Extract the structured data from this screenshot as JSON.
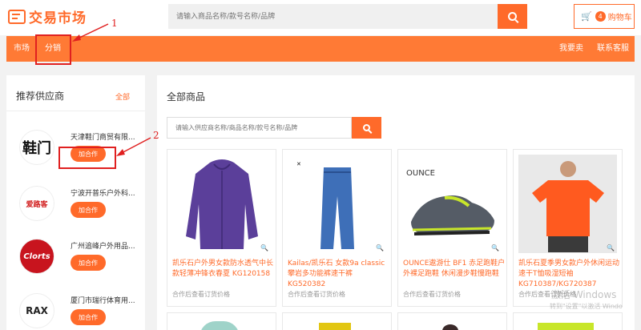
{
  "header": {
    "logo_text": "交易市场",
    "search_placeholder": "请输入商品名称/款号名称/品牌",
    "cart_count": "4",
    "cart_label": "购物车"
  },
  "nav": {
    "left": [
      "市场",
      "分销"
    ],
    "right": [
      "我要卖",
      "联系客服"
    ]
  },
  "annotations": [
    "1",
    "2"
  ],
  "sidebar": {
    "title": "推荐供应商",
    "all_link": "全部",
    "suppliers": [
      {
        "name": "天津鞋门商贸有限...",
        "button": "加合作",
        "logo": "鞋门"
      },
      {
        "name": "宁波开普乐户外科...",
        "button": "加合作",
        "logo": "爱路客"
      },
      {
        "name": "广州追峰户外用品...",
        "button": "加合作",
        "logo": "Clorts"
      },
      {
        "name": "厦门市瑞行体育用...",
        "button": "加合作",
        "logo": "RAX"
      }
    ]
  },
  "main": {
    "title": "全部商品",
    "search_placeholder": "请输入供应商名称/商品名称/款号名称/品牌",
    "products": [
      {
        "name": "凯乐石户外男女款防水透气中长款轻薄冲锋衣春夏 KG120158",
        "price_note": "合作后查看订货价格",
        "color": "#5b3f9a",
        "kind": "jacket"
      },
      {
        "name": "Kailas/凯乐石 女款9a classic 攀岩多功能裤速干裤 KG520382",
        "price_note": "合作后查看订货价格",
        "color": "#3e6fb8",
        "kind": "pants"
      },
      {
        "name": "OUNCE遨游仕 BF1 赤足跑鞋户外裸足跑鞋 休闲漫步鞋慢跑鞋",
        "price_note": "合作后查看订货价格",
        "color": "#555c66",
        "kind": "shoe"
      },
      {
        "name": "凯乐石夏季男女款户外休闲运动速干T恤吸湿短袖 KG710387/KG720387",
        "price_note": "合作后查看订货价格",
        "color": "#ff5a1f",
        "kind": "tshirt"
      }
    ]
  },
  "watermark": {
    "line1": "激活 Windows",
    "line2": "转到\"设置\"以激活 Windo"
  }
}
